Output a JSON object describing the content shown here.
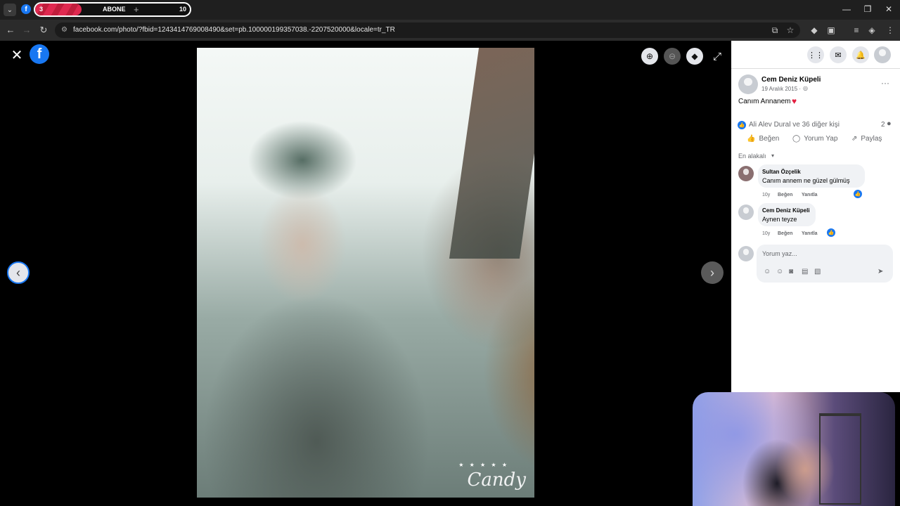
{
  "browser": {
    "subscriber_widget": {
      "current": "3",
      "label": "ABONE",
      "plus": "+",
      "goal": "10",
      "progress": 0.3
    },
    "url": "facebook.com/photo/?fbid=1243414769008490&set=pb.100000199357038.-2207520000&locale=tr_TR"
  },
  "post": {
    "author": "Cem Deniz Küpeli",
    "date": "19 Aralık 2015 · ",
    "caption": "Canım Annanem",
    "reactions": "Ali Alev Dural ve 36 diğer kişi",
    "comment_count": "2",
    "actions": {
      "like": "Beğen",
      "comment": "Yorum Yap",
      "share": "Paylaş"
    },
    "sort_label": "En alakalı"
  },
  "comments": [
    {
      "author": "Sultan Özçelik",
      "text": "Canım annem ne güzel gülmüş",
      "age": "10y",
      "like": "Beğen",
      "reply": "Yanıtla"
    },
    {
      "author": "Cem Deniz Küpeli",
      "text": "Aynen teyze",
      "age": "10y",
      "like": "Beğen",
      "reply": "Yanıtla"
    }
  ],
  "composer": {
    "placeholder": "Yorum yaz..."
  },
  "photo": {
    "watermark": "Candy",
    "watermark_stars": "★ ★ ★ ★ ★"
  },
  "colors": {
    "accent": "#1877f2",
    "heart": "#e41e3f",
    "subscriber_bar": "#e02950"
  }
}
